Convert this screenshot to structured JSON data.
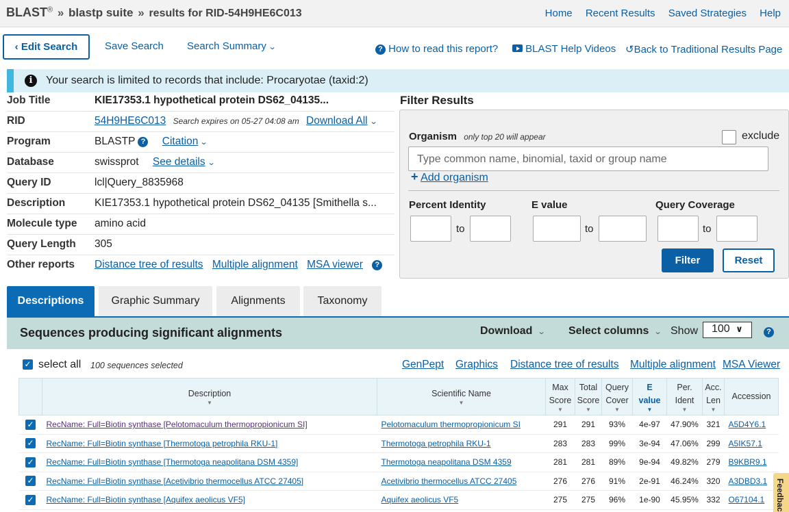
{
  "header": {
    "brand": "BLAST",
    "reg": "®",
    "sep": "»",
    "suite": "blastp suite",
    "results_for": "results for RID-54H9HE6C013",
    "nav": [
      "Home",
      "Recent Results",
      "Saved Strategies",
      "Help"
    ]
  },
  "toolbar": {
    "edit_search": "Edit Search",
    "save_search": "Save Search",
    "search_summary": "Search Summary",
    "how_to_read": "How to read this report?",
    "help_videos": "BLAST Help Videos",
    "back_traditional": "Back to Traditional Results Page"
  },
  "notice": {
    "text": "Your search is limited to records that include: Procaryotae (taxid:2)"
  },
  "job": {
    "title_label": "Job Title",
    "title": "KIE17353.1 hypothetical protein DS62_04135...",
    "rid_label": "RID",
    "rid": "54H9HE6C013",
    "expires": "Search expires on 05-27 04:08 am",
    "download_all": "Download All",
    "program_label": "Program",
    "program": "BLASTP",
    "citation": "Citation",
    "database_label": "Database",
    "database": "swissprot",
    "see_details": "See details",
    "query_id_label": "Query ID",
    "query_id": "lcl|Query_8835968",
    "description_label": "Description",
    "description": "KIE17353.1 hypothetical protein DS62_04135 [Smithella s...",
    "molecule_label": "Molecule type",
    "molecule": "amino acid",
    "query_length_label": "Query Length",
    "query_length": "305",
    "other_reports_label": "Other reports",
    "distance_tree": "Distance tree of results",
    "multiple_alignment": "Multiple alignment",
    "msa_viewer": "MSA viewer"
  },
  "filter": {
    "title": "Filter Results",
    "organism_label": "Organism",
    "organism_hint": "only top 20 will appear",
    "exclude": "exclude",
    "organism_placeholder": "Type common  name, binomial, taxid or group  name",
    "add_organism": "Add organism",
    "percent_identity": "Percent Identity",
    "e_value": "E value",
    "query_coverage": "Query Coverage",
    "to": "to",
    "filter_btn": "Filter",
    "reset_btn": "Reset"
  },
  "tabs": [
    "Descriptions",
    "Graphic Summary",
    "Alignments",
    "Taxonomy"
  ],
  "results": {
    "title": "Sequences producing significant alignments",
    "download": "Download",
    "select_columns": "Select columns",
    "show": "Show",
    "show_value": "100",
    "select_all": "select all",
    "selected_count": "100 sequences selected",
    "links": [
      "GenPept",
      "Graphics",
      "Distance tree of results",
      "Multiple alignment",
      "MSA Viewer"
    ],
    "columns": {
      "description": "Description",
      "scientific_name": "Scientific Name",
      "max_score": [
        "Max",
        "Score"
      ],
      "total_score": [
        "Total",
        "Score"
      ],
      "query_cover": [
        "Query",
        "Cover"
      ],
      "e_value": [
        "E",
        "value"
      ],
      "per_ident": [
        "Per.",
        "Ident"
      ],
      "acc_len": [
        "Acc.",
        "Len"
      ],
      "accession": "Accession"
    },
    "rows": [
      {
        "description": "RecName: Full=Biotin synthase [Pelotomaculum thermopropionicum SI]",
        "scientific_name": "Pelotomaculum thermopropionicum SI",
        "max_score": "291",
        "total_score": "291",
        "query_cover": "93%",
        "e_value": "4e-97",
        "per_ident": "47.90%",
        "acc_len": "321",
        "accession": "A5D4Y6.1"
      },
      {
        "description": "RecName: Full=Biotin synthase [Thermotoga petrophila RKU-1]",
        "scientific_name": "Thermotoga petrophila RKU-1",
        "max_score": "283",
        "total_score": "283",
        "query_cover": "99%",
        "e_value": "3e-94",
        "per_ident": "47.06%",
        "acc_len": "299",
        "accession": "A5IK57.1"
      },
      {
        "description": "RecName: Full=Biotin synthase [Thermotoga neapolitana DSM 4359]",
        "scientific_name": "Thermotoga neapolitana DSM 4359",
        "max_score": "281",
        "total_score": "281",
        "query_cover": "89%",
        "e_value": "9e-94",
        "per_ident": "49.82%",
        "acc_len": "279",
        "accession": "B9KBR9.1"
      },
      {
        "description": "RecName: Full=Biotin synthase [Acetivibrio thermocellus ATCC 27405]",
        "scientific_name": "Acetivibrio thermocellus ATCC 27405",
        "max_score": "276",
        "total_score": "276",
        "query_cover": "91%",
        "e_value": "2e-91",
        "per_ident": "46.24%",
        "acc_len": "320",
        "accession": "A3DBD3.1"
      },
      {
        "description": "RecName: Full=Biotin synthase [Aquifex aeolicus VF5]",
        "scientific_name": "Aquifex aeolicus VF5",
        "max_score": "275",
        "total_score": "275",
        "query_cover": "96%",
        "e_value": "1e-90",
        "per_ident": "45.95%",
        "acc_len": "332",
        "accession": "O67104.1"
      }
    ]
  },
  "feedback": "Feedback",
  "colors": {
    "primary": "#0b5fa5",
    "tab_active": "#0b6bb5",
    "notice_bg": "#dbeff6",
    "section_bg": "#c4dcd9"
  }
}
